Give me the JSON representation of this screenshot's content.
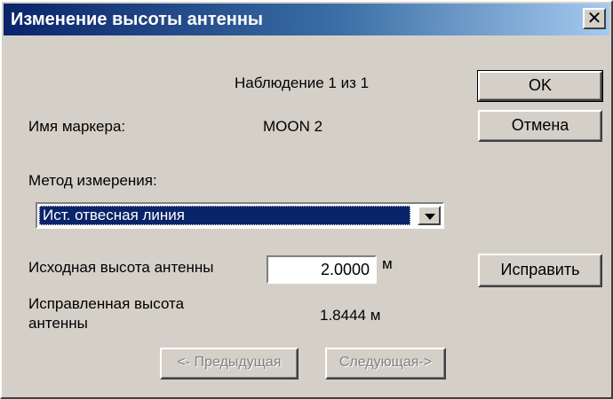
{
  "window": {
    "title": "Изменение высоты антенны",
    "close_glyph": "✕"
  },
  "observation": {
    "text": "Наблюдение 1 из 1"
  },
  "marker": {
    "label": "Имя маркера:",
    "value": "MOON 2"
  },
  "method": {
    "label": "Метод измерения:",
    "selected": "Ист. отвесная линия"
  },
  "source_height": {
    "label": "Исходная высота антенны",
    "value": "2.0000",
    "unit": "м"
  },
  "corrected_height": {
    "label_line1": "Исправленная высота",
    "label_line2": "антенны",
    "value": "1.8444 м"
  },
  "buttons": {
    "ok": "OK",
    "cancel": "Отмена",
    "fix": "Исправить",
    "prev": "<- Предыдущая",
    "next": "Следующая->"
  },
  "colors": {
    "dialog_bg": "#d4d0c8",
    "title_start": "#0a246a",
    "title_end": "#a6caf0",
    "selection": "#0a246a"
  }
}
